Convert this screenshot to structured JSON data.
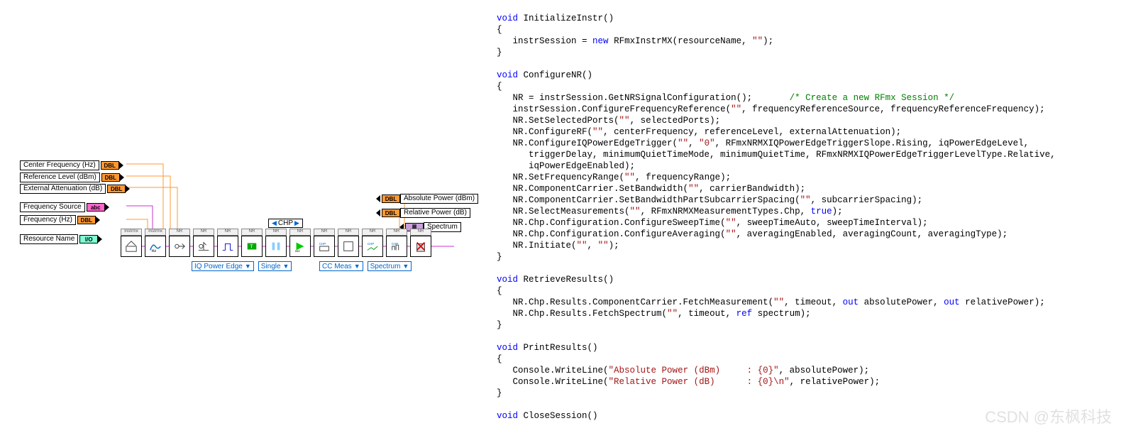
{
  "labview": {
    "inputs": [
      {
        "label": "Center Frequency (Hz)",
        "type": "DBL"
      },
      {
        "label": "Reference Level (dBm)",
        "type": "DBL"
      },
      {
        "label": "External Attenuation (dB)",
        "type": "DBL"
      },
      {
        "label": "Frequency Source",
        "type": "abc"
      },
      {
        "label": "Frequency (Hz)",
        "type": "DBL"
      },
      {
        "label": "Resource Name",
        "type": "I/O"
      }
    ],
    "outputs": [
      {
        "label": "Absolute Power (dBm)",
        "type": "DBL"
      },
      {
        "label": "Relative Power (dB)",
        "type": "DBL"
      },
      {
        "label": "Spectrum",
        "type": "cluster"
      }
    ],
    "chp_enum": "CHP",
    "nodes": [
      "Instrmx",
      "Instrmx",
      "NR",
      "NR",
      "NR",
      "NR",
      "NR",
      "NR",
      "NR",
      "NR",
      "NR",
      "NR",
      "NR"
    ],
    "dropdowns1": [
      "IQ Power Edge",
      "Single"
    ],
    "dropdowns2": [
      "CC Meas",
      "Spectrum"
    ]
  },
  "code": {
    "fn1_sig": "InitializeInstr",
    "fn1_body": "instrSession = ",
    "fn1_new": "new",
    "fn1_rest": " RFmxInstrMX(resourceName, ",
    "empty_str": "\"\"",
    "close_paren": ");",
    "fn2_sig": "ConfigureNR",
    "fn2_l1a": "NR = instrSession.GetNRSignalConfiguration();",
    "fn2_l1c": "/* Create a new RFmx Session */",
    "fn2_l2": "instrSession.ConfigureFrequencyReference(",
    "fn2_l2b": ", frequencyReferenceSource, frequencyReferenceFrequency);",
    "fn2_l3": "NR.SetSelectedPorts(",
    "fn2_l3b": ", selectedPorts);",
    "fn2_l4": "NR.ConfigureRF(",
    "fn2_l4b": ", centerFrequency, referenceLevel, externalAttenuation);",
    "fn2_l5": "NR.ConfigureIQPowerEdgeTrigger(",
    "fn2_l5a": ", ",
    "zero_str": "\"0\"",
    "fn2_l5b": ", RFmxNRMXIQPowerEdgeTriggerSlope.Rising, iqPowerEdgeLevel,",
    "fn2_l5c": "triggerDelay, minimumQuietTimeMode, minimumQuietTime, RFmxNRMXIQPowerEdgeTriggerLevelType.Relative,",
    "fn2_l5d": "iqPowerEdgeEnabled);",
    "fn2_l6": "NR.SetFrequencyRange(",
    "fn2_l6b": ", frequencyRange);",
    "fn2_l7": "NR.ComponentCarrier.SetBandwidth(",
    "fn2_l7b": ", carrierBandwidth);",
    "fn2_l8": "NR.ComponentCarrier.SetBandwidthPartSubcarrierSpacing(",
    "fn2_l8b": ", subcarrierSpacing);",
    "fn2_l9": "NR.SelectMeasurements(",
    "fn2_l9b": ", RFmxNRMXMeasurementTypes.Chp, ",
    "true_kw": "true",
    "fn2_l10": "NR.Chp.Configuration.ConfigureSweepTime(",
    "fn2_l10b": ", sweepTimeAuto, sweepTimeInterval);",
    "fn2_l11": "NR.Chp.Configuration.ConfigureAveraging(",
    "fn2_l11b": ", averagingEnabled, averagingCount, averagingType);",
    "fn2_l12": "NR.Initiate(",
    "fn3_sig": "RetrieveResults",
    "fn3_l1": "NR.Chp.Results.ComponentCarrier.FetchMeasurement(",
    "fn3_l1b": ", timeout, ",
    "out_kw": "out",
    "fn3_l1c": " absolutePower, ",
    "fn3_l1d": " relativePower);",
    "fn3_l2": "NR.Chp.Results.FetchSpectrum(",
    "ref_kw": "ref",
    "fn3_l2b": " spectrum);",
    "fn4_sig": "PrintResults",
    "fn4_l1a": "Console.WriteLine(",
    "fn4_l1s": "\"Absolute Power (dBm)     : {0}\"",
    "fn4_l1b": ", absolutePower);",
    "fn4_l2s": "\"Relative Power (dB)      : {0}\\n\"",
    "fn4_l2b": ", relativePower);",
    "fn5_sig": "CloseSession",
    "void": "void",
    "brace_o": "{",
    "brace_c": "}",
    "paren_empty": "()"
  },
  "watermark": "CSDN @东枫科技"
}
